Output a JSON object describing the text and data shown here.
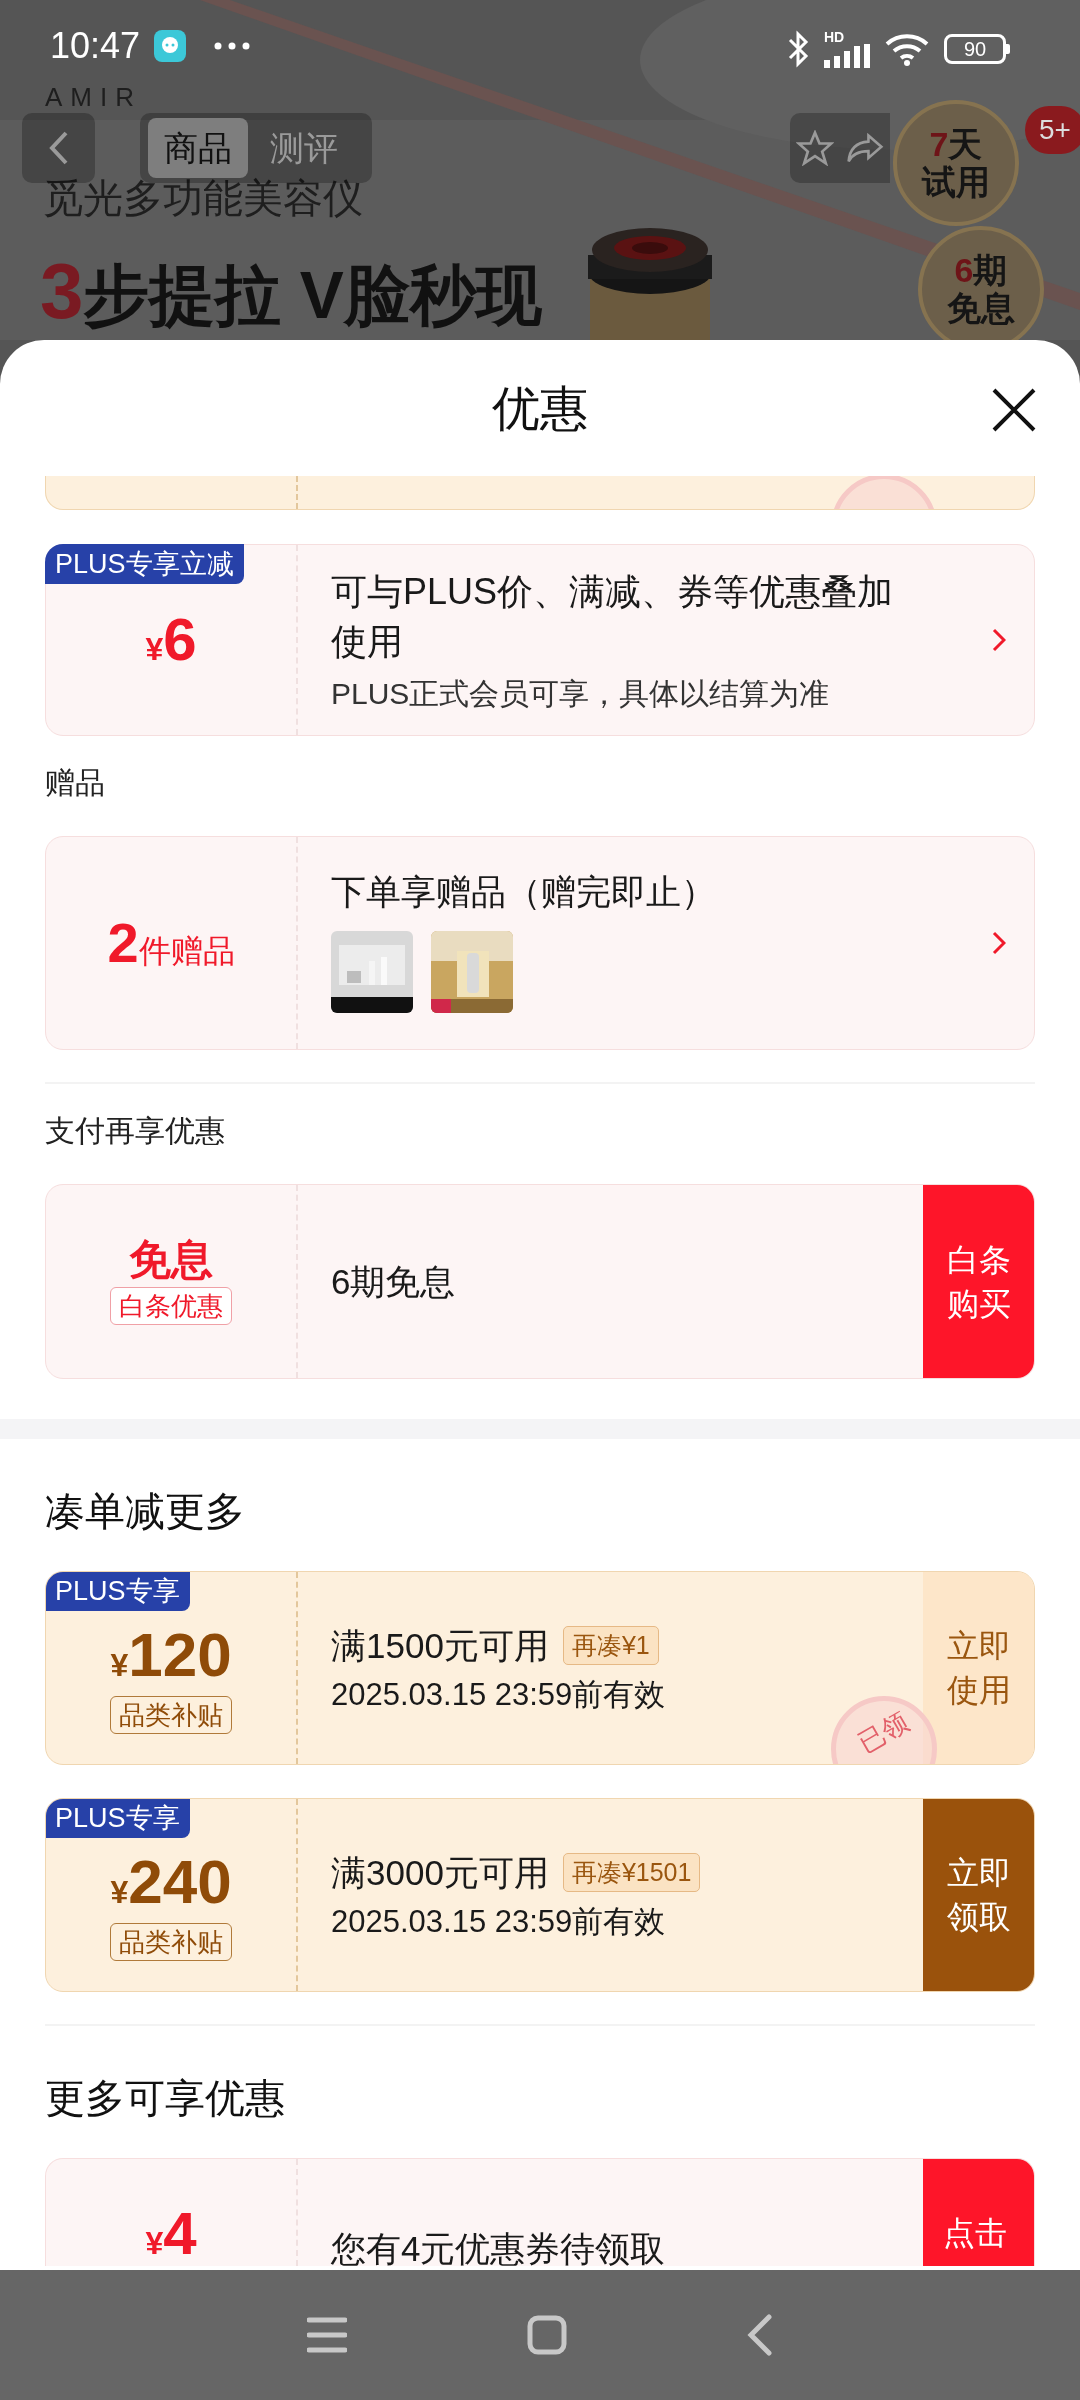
{
  "status_bar": {
    "time": "10:47",
    "network": "HD",
    "battery": "90"
  },
  "header": {
    "brand": "AMIR",
    "product_name": "觅光多功能美容仪",
    "headline_number": "3",
    "headline": "步提拉 V脸秒现",
    "tabs": [
      {
        "label": "商品",
        "selected": true
      },
      {
        "label": "测评",
        "selected": false
      }
    ],
    "badges": [
      {
        "lines": [
          "7天",
          "试用"
        ]
      },
      {
        "lines": [
          "6期",
          "免息"
        ]
      }
    ],
    "notification_count": "5+"
  },
  "sheet": {
    "title": "优惠"
  },
  "groups": [
    {
      "sections": [
        {
          "cards": [
            {
              "kind": "cut",
              "claimed": true
            },
            {
              "kind": "offer",
              "badge": "PLUS专享立减",
              "currency": "¥",
              "amount": "6",
              "title": "可与PLUS价、满减、券等优惠叠加使用",
              "note": "PLUS正式会员可享，具体以结算为准"
            }
          ]
        },
        {
          "kind": "minor",
          "divided": false,
          "heading": "赠品",
          "cards": [
            {
              "kind": "gift",
              "count": "2",
              "unit": "件赠品",
              "title": "下单享赠品（赠完即止）"
            }
          ]
        },
        {
          "kind": "minor",
          "divided": true,
          "heading": "支付再享优惠",
          "cards": [
            {
              "kind": "payment",
              "label": "免息",
              "tag": "白条优惠",
              "title": "6期免息",
              "action": "白条购买"
            }
          ]
        }
      ]
    },
    {
      "sections": [
        {
          "kind": "major",
          "divided": false,
          "heading": "凑单减更多",
          "cards": [
            {
              "kind": "coupon",
              "badge": "PLUS专享",
              "currency": "¥",
              "amount": "120",
              "tag": "品类补贴",
              "title": "满1500元可用",
              "extra": "再凑¥1",
              "validity": "2025.03.15 23:59前有效",
              "action": "立即使用",
              "claimed": true,
              "stamp": "已领"
            },
            {
              "kind": "coupon",
              "badge": "PLUS专享",
              "currency": "¥",
              "amount": "240",
              "tag": "品类补贴",
              "title": "满3000元可用",
              "extra": "再凑¥1501",
              "validity": "2025.03.15 23:59前有效",
              "action": "立即领取",
              "claimed": false
            }
          ]
        },
        {
          "kind": "major",
          "divided": true,
          "heading": "更多可享优惠",
          "cards": [
            {
              "kind": "voucher",
              "currency": "¥",
              "amount": "4",
              "title": "您有4元优惠券待领取",
              "action": "点击"
            }
          ]
        }
      ]
    }
  ]
}
